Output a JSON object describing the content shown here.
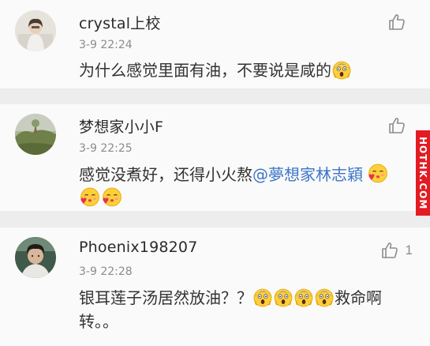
{
  "watermark": "HOTHK.COM",
  "comments": [
    {
      "username": "crystal上校",
      "time": "3-9 22:24",
      "text_before": "为什么感觉里面有油，不要说是咸的",
      "likes": "",
      "emoji": [
        "scream-emoji"
      ]
    },
    {
      "username": "梦想家小小F",
      "time": "3-9 22:25",
      "text_before": "感觉没煮好，还得小火熬",
      "mention": "@夢想家林志穎",
      "likes": "",
      "emoji": [
        "kiss-emoji",
        "kiss-emoji",
        "kiss-emoji"
      ]
    },
    {
      "username": "Phoenix198207",
      "time": "3-9 22:28",
      "text_before": "银耳莲子汤居然放油？？",
      "text_after": "救命啊",
      "text_line2": "转。。",
      "likes": "1",
      "emoji": [
        "scream-emoji",
        "scream-emoji",
        "scream-emoji",
        "scream-emoji"
      ]
    }
  ],
  "colors": {
    "mention": "#3d75c9",
    "background": "#ededed",
    "card": "#fafafa",
    "watermark": "#e31b23"
  }
}
